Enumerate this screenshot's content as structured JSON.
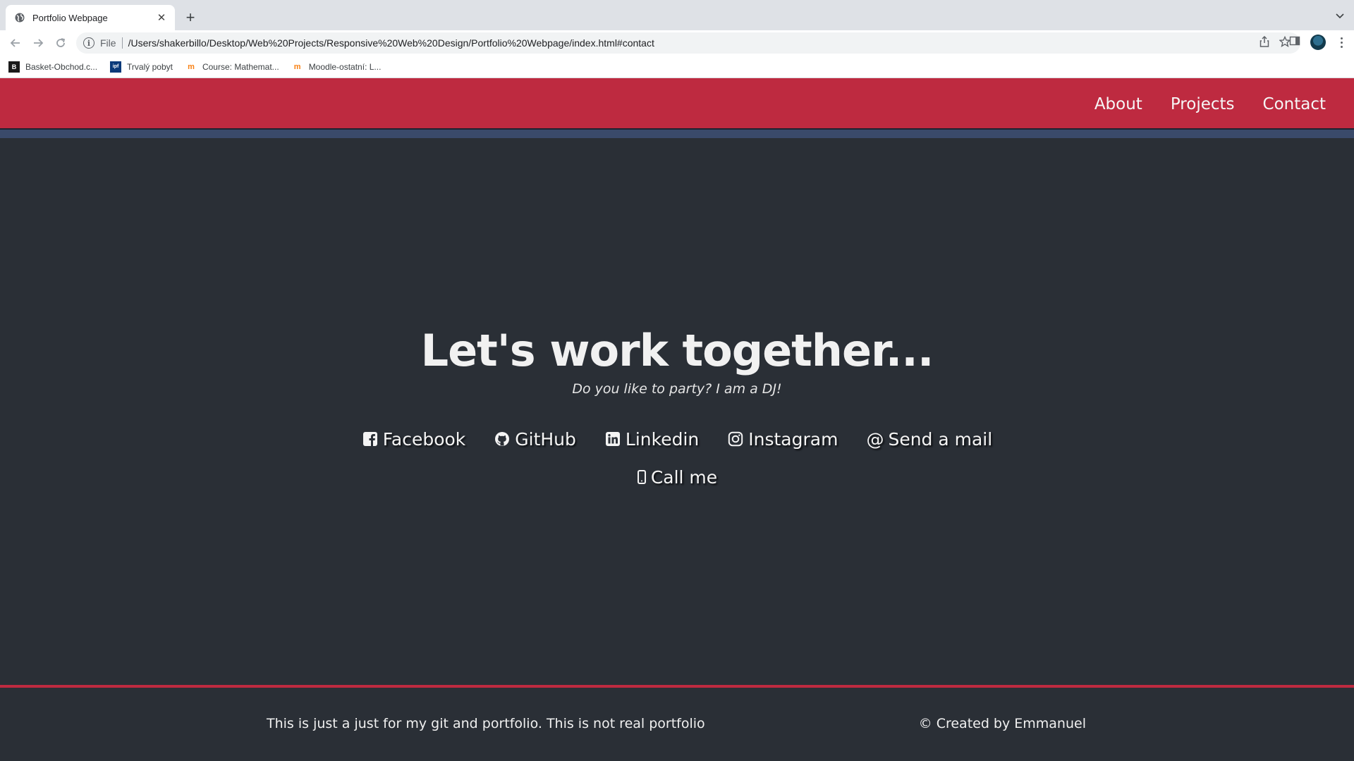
{
  "browser": {
    "tab": {
      "title": "Portfolio Webpage"
    },
    "omnibox": {
      "scheme": "File",
      "url": "/Users/shakerbillo/Desktop/Web%20Projects/Responsive%20Web%20Design/Portfolio%20Webpage/index.html#contact"
    },
    "bookmarks": [
      {
        "label": "Basket-Obchod.c..."
      },
      {
        "label": "Trvalý pobyt"
      },
      {
        "label": "Course: Mathemat..."
      },
      {
        "label": "Moodle-ostatní: L..."
      }
    ]
  },
  "site": {
    "nav": [
      {
        "label": "About"
      },
      {
        "label": "Projects"
      },
      {
        "label": "Contact"
      }
    ],
    "contact": {
      "title": "Let's work together...",
      "subtitle": "Do you like to party? I am a DJ!",
      "links": [
        {
          "label": "Facebook",
          "icon": "facebook-icon"
        },
        {
          "label": "GitHub",
          "icon": "github-icon"
        },
        {
          "label": "Linkedin",
          "icon": "linkedin-icon"
        },
        {
          "label": "Instagram",
          "icon": "instagram-icon"
        },
        {
          "label": "Send a mail",
          "icon": "at-icon"
        },
        {
          "label": "Call me",
          "icon": "phone-icon"
        }
      ]
    },
    "footer": {
      "left": "This is just a just for my git and portfolio. This is not real portfolio",
      "right": "© Created by Emmanuel"
    }
  },
  "colors": {
    "header": "#be2a40",
    "stripe": "#3a4a6a",
    "background": "#2a2f36",
    "text": "#f1f1f1"
  }
}
